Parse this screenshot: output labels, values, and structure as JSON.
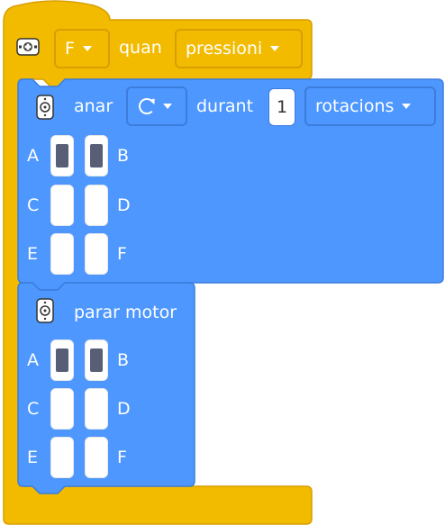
{
  "hat_block": {
    "button_value": "F",
    "when_label": "quan",
    "event_value": "pressioni",
    "brick_icon": "button-brick-icon"
  },
  "motor_run_block": {
    "label": "anar",
    "direction_icon": "clockwise-rotation-icon",
    "for_label": "durant",
    "amount": "1",
    "unit_value": "rotacions",
    "motor_icon": "motor-icon",
    "ports": [
      {
        "name": "A",
        "selected": true
      },
      {
        "name": "B",
        "selected": true
      },
      {
        "name": "C",
        "selected": false
      },
      {
        "name": "D",
        "selected": false
      },
      {
        "name": "E",
        "selected": false
      },
      {
        "name": "F",
        "selected": false
      }
    ]
  },
  "motor_stop_block": {
    "label": "parar motor",
    "motor_icon": "motor-icon",
    "ports": [
      {
        "name": "A",
        "selected": true
      },
      {
        "name": "B",
        "selected": true
      },
      {
        "name": "C",
        "selected": false
      },
      {
        "name": "D",
        "selected": false
      },
      {
        "name": "E",
        "selected": false
      },
      {
        "name": "F",
        "selected": false
      }
    ]
  },
  "colors": {
    "event_yellow": "#f2bb00",
    "event_yellow_border": "#d79f00",
    "motion_blue": "#4d97ff",
    "motion_blue_border": "#3c7ddc",
    "port_fill": "#575e75"
  }
}
